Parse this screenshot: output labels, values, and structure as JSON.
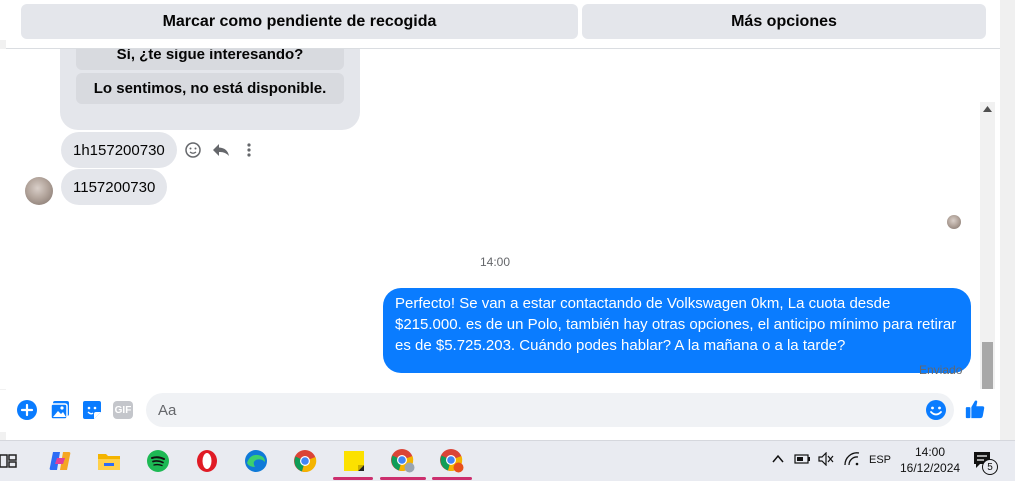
{
  "top_actions": {
    "mark_pending": "Marcar como pendiente de recogida",
    "more_options": "Más opciones"
  },
  "conversation": {
    "quick_replies": [
      "Sí, ¿te sigue interesando?",
      "Lo sentimos, no está disponible."
    ],
    "incoming_messages": [
      "1h157200730",
      "1157200730"
    ],
    "timestamp": "14:00",
    "outgoing_message": "Perfecto!  Se van a estar contactando de Volkswagen 0km, La cuota desde $215.000. es de un Polo, también hay otras opciones, el anticipo mínimo para retirar es de $5.725.203. Cuándo podes hablar? A la mañana o a la tarde?",
    "outgoing_status": "Enviado",
    "accent_color": "#0a7cff"
  },
  "composer": {
    "placeholder": "Aa",
    "icons": [
      "plus-icon",
      "photo-icon",
      "sticker-icon",
      "gif-icon",
      "emoji-icon",
      "like-icon"
    ],
    "gif_label": "GIF"
  },
  "taskbar": {
    "apps": [
      "task-view",
      "copilot",
      "file-explorer",
      "spotify",
      "opera",
      "edge",
      "chrome",
      "sticky-notes",
      "chrome-profile-1",
      "chrome-profile-2"
    ],
    "language": "ESP",
    "time": "14:00",
    "date": "16/12/2024",
    "notification_count": "5"
  }
}
